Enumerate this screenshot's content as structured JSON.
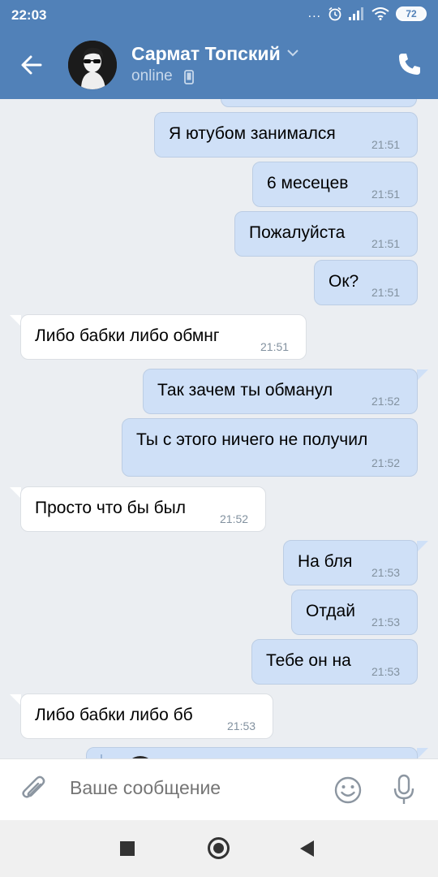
{
  "status_bar": {
    "time": "22:03",
    "more_indicator": "...",
    "battery": "72"
  },
  "header": {
    "contact_name": "Сармат Топский",
    "status": "online",
    "icons": {
      "back": "arrow-left-icon",
      "dropdown": "chevron-down-icon",
      "device": "mobile-phone-icon",
      "call": "phone-icon"
    }
  },
  "messages": [
    {
      "dir": "out",
      "text": "Я ютубом занимался",
      "time": "21:51"
    },
    {
      "dir": "out",
      "text": "6 месецев",
      "time": "21:51"
    },
    {
      "dir": "out",
      "text": "Пожалуйста",
      "time": "21:51"
    },
    {
      "dir": "out",
      "text": "Ок?",
      "time": "21:51"
    },
    {
      "dir": "in",
      "text": "Либо бабки либо обмнг",
      "time": "21:51"
    },
    {
      "dir": "out",
      "text": "Так зачем ты обманул",
      "time": "21:52"
    },
    {
      "dir": "out",
      "text": "Ты с этого ничего не получил",
      "time": "21:52"
    },
    {
      "dir": "in",
      "text": "Просто что бы был",
      "time": "21:52"
    },
    {
      "dir": "out",
      "text": "На бля",
      "time": "21:53"
    },
    {
      "dir": "out",
      "text": "Отдай",
      "time": "21:53"
    },
    {
      "dir": "out",
      "text": "Тебе он на",
      "time": "21:53"
    },
    {
      "dir": "in",
      "text": "Либо бабки либо бб",
      "time": "21:53"
    }
  ],
  "composer": {
    "placeholder": "Ваше сообщение",
    "icons": {
      "attach": "paperclip-icon",
      "emoji": "smiley-icon",
      "mic": "microphone-icon"
    }
  },
  "colors": {
    "accent": "#5181b8",
    "outgoing_bubble": "#cfe0f7",
    "incoming_bubble": "#ffffff",
    "background": "#ebeef2"
  }
}
